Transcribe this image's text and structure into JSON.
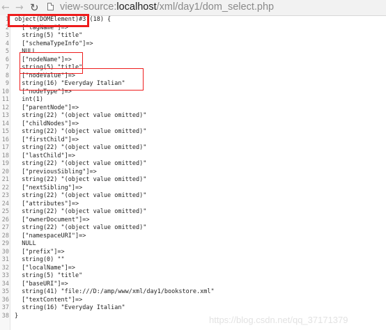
{
  "toolbar": {
    "back_icon": "arrow-left-icon",
    "forward_icon": "arrow-right-icon",
    "reload_icon": "reload-icon",
    "url_prefix": "view-source:",
    "url_host": "localhost",
    "url_path": "/xml/day1/dom_select.php"
  },
  "code": {
    "line_numbers": [
      "1",
      "2",
      "3",
      "4",
      "5",
      "6",
      "7",
      "8",
      "9",
      "10",
      "11",
      "12",
      "13",
      "14",
      "15",
      "16",
      "17",
      "18",
      "19",
      "20",
      "21",
      "22",
      "23",
      "24",
      "25",
      "26",
      "27",
      "28",
      "29",
      "30",
      "31",
      "32",
      "33",
      "34",
      "35",
      "36",
      "37",
      "38"
    ],
    "lines": [
      "object(DOMElement)#3 (18) {",
      "  [\"tagName\"]=>",
      "  string(5) \"title\"",
      "  [\"schemaTypeInfo\"]=>",
      "  NULL",
      "  [\"nodeName\"]=>",
      "  string(5) \"title\"",
      "  [\"nodeValue\"]=>",
      "  string(16) \"Everyday Italian\"",
      "  [\"nodeType\"]=>",
      "  int(1)",
      "  [\"parentNode\"]=>",
      "  string(22) \"(object value omitted)\"",
      "  [\"childNodes\"]=>",
      "  string(22) \"(object value omitted)\"",
      "  [\"firstChild\"]=>",
      "  string(22) \"(object value omitted)\"",
      "  [\"lastChild\"]=>",
      "  string(22) \"(object value omitted)\"",
      "  [\"previousSibling\"]=>",
      "  string(22) \"(object value omitted)\"",
      "  [\"nextSibling\"]=>",
      "  string(22) \"(object value omitted)\"",
      "  [\"attributes\"]=>",
      "  string(22) \"(object value omitted)\"",
      "  [\"ownerDocument\"]=>",
      "  string(22) \"(object value omitted)\"",
      "  [\"namespaceURI\"]=>",
      "  NULL",
      "  [\"prefix\"]=>",
      "  string(0) \"\"",
      "  [\"localName\"]=>",
      "  string(5) \"title\"",
      "  [\"baseURI\"]=>",
      "  string(41) \"file:///D:/amp/www/xml/day1/bookstore.xml\"",
      "  [\"textContent\"]=>",
      "  string(16) \"Everyday Italian\"",
      "}"
    ]
  },
  "annotation_color": "#ee1c1c",
  "watermark": "https://blog.csdn.net/qq_37171379"
}
